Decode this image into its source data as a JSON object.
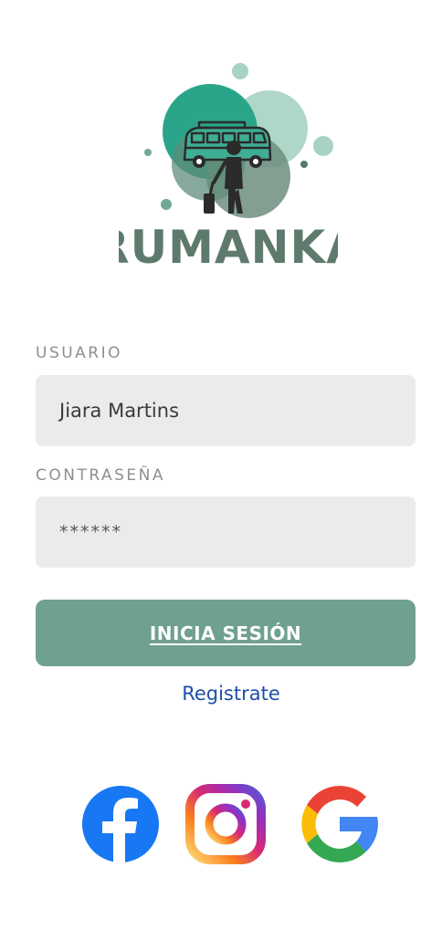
{
  "brand": {
    "name": "RUMANKA"
  },
  "form": {
    "username_label": "USUARIO",
    "username_value": "Jiara Martins",
    "password_label": "CONTRASEÑA",
    "password_value": "******",
    "login_label": "Inicia sesión",
    "register_label": "Registrate"
  },
  "social": [
    {
      "name": "facebook-icon"
    },
    {
      "name": "instagram-icon"
    },
    {
      "name": "google-icon"
    }
  ],
  "colors": {
    "accent": "#70a08e",
    "field_bg": "#ebebeb",
    "link": "#1d4fa8",
    "logo_teal": "#2aa58a",
    "logo_dark": "#5e7a6d"
  }
}
